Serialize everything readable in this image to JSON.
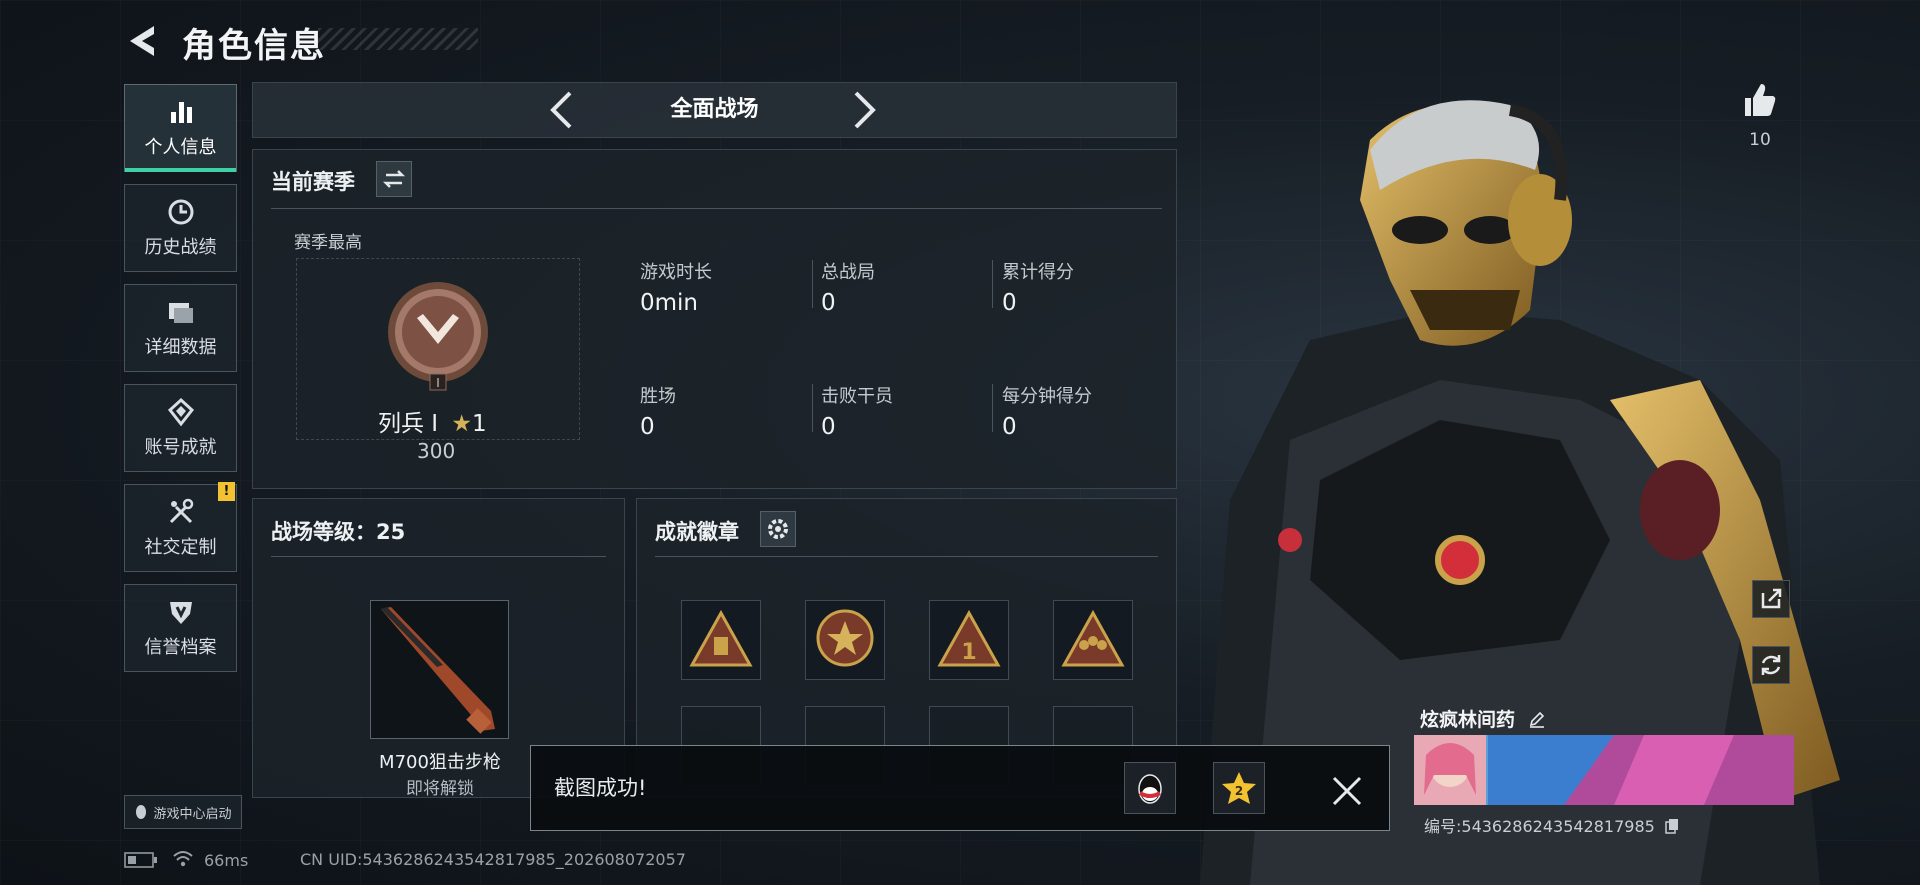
{
  "header": {
    "title": "角色信息"
  },
  "sidebar": {
    "items": [
      {
        "label": "个人信息",
        "icon": "bar-chart-icon",
        "active": true
      },
      {
        "label": "历史战绩",
        "icon": "clock-icon"
      },
      {
        "label": "详细数据",
        "icon": "folder-icon"
      },
      {
        "label": "账号成就",
        "icon": "achievement-icon"
      },
      {
        "label": "社交定制",
        "icon": "tools-icon",
        "alert": "!"
      },
      {
        "label": "信誉档案",
        "icon": "shield-icon"
      }
    ],
    "game_center_label": "游戏中心启动"
  },
  "mode_selector": {
    "label": "全面战场"
  },
  "season": {
    "title": "当前赛季",
    "best_label": "赛季最高",
    "rank_name": "列兵 I",
    "rank_stars": "1",
    "rank_badge_digit": "I",
    "rank_score": "300",
    "stats": [
      {
        "label": "游戏时长",
        "value": "0min"
      },
      {
        "label": "总战局",
        "value": "0"
      },
      {
        "label": "累计得分",
        "value": "0"
      },
      {
        "label": "胜场",
        "value": "0"
      },
      {
        "label": "击败干员",
        "value": "0"
      },
      {
        "label": "每分钟得分",
        "value": "0"
      }
    ]
  },
  "level": {
    "title": "战场等级：25",
    "weapon_name": "M700狙击步枪",
    "weapon_status": "即将解锁"
  },
  "achievements": {
    "title": "成就徽章",
    "badge_digit": "1"
  },
  "toast": {
    "message": "截图成功!",
    "badge_digit": "2"
  },
  "profile": {
    "like_count": "10",
    "player_name": "炫疯林间药",
    "player_id": "编号:5436286243542817985"
  },
  "footer": {
    "ping": "66ms",
    "uid": "CN UID:5436286243542817985_202608072057"
  },
  "colors": {
    "accent": "#3ed1a5",
    "alert": "#f2c230",
    "gold": "#c9a24a"
  }
}
